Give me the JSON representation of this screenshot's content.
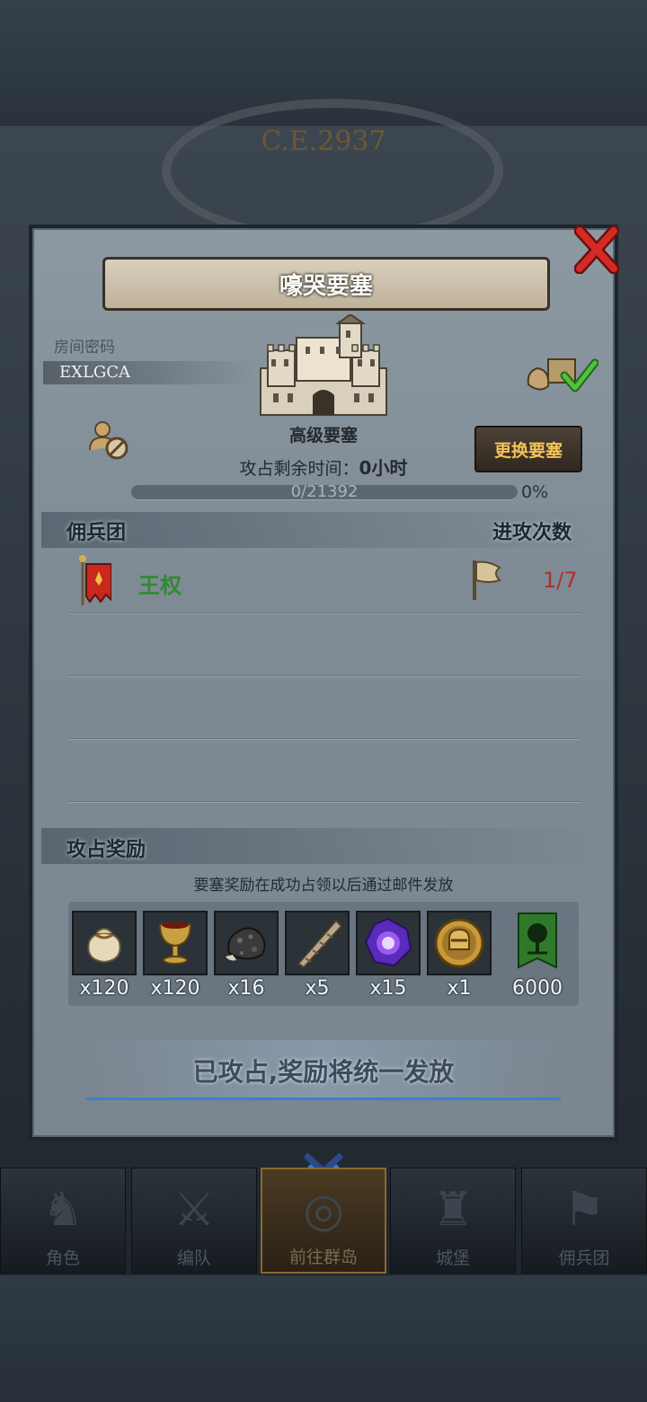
{
  "background": {
    "era": "C.E.2937"
  },
  "dialog": {
    "title": "嚎哭要塞",
    "room_label": "房间密码",
    "room_code": "EXLGCA",
    "fortress_type": "高级要塞",
    "time_left_label": "攻占剩余时间：",
    "time_left_value": "0小时",
    "progress_text": "0/21392",
    "progress_percent": "0%",
    "progress_fraction": 0,
    "change_button": "更换要塞",
    "mercenary_header": "佣兵团",
    "attack_count_header": "进攻次数",
    "mercenaries": [
      {
        "name": "王权",
        "attacks": "1/7"
      }
    ],
    "rewards_header": "攻占奖励",
    "reward_notice": "要塞奖励在成功占领以后通过邮件发放",
    "rewards": [
      {
        "icon": "pouch-icon",
        "qty": "x120"
      },
      {
        "icon": "goblet-icon",
        "qty": "x120"
      },
      {
        "icon": "ore-icon",
        "qty": "x16"
      },
      {
        "icon": "horn-icon",
        "qty": "x5"
      },
      {
        "icon": "magic-crystal-icon",
        "qty": "x15"
      },
      {
        "icon": "helmet-medal-icon",
        "qty": "x1"
      },
      {
        "icon": "tree-banner-icon",
        "qty": "6000"
      }
    ],
    "result_text": "已攻占,奖励将统一发放"
  },
  "nav": {
    "items": [
      {
        "label": "角色",
        "icon": "knight-icon"
      },
      {
        "label": "编队",
        "icon": "squad-icon"
      },
      {
        "label": "前往群岛",
        "icon": "islands-icon"
      },
      {
        "label": "城堡",
        "icon": "castle-icon"
      },
      {
        "label": "佣兵团",
        "icon": "mercenary-icon"
      }
    ],
    "active_index": 2
  },
  "colors": {
    "accent_gold": "#f2c35a",
    "merc_name_green": "#2f8a32",
    "attack_count_red": "#b03030",
    "result_underline_blue": "#3b7fd0",
    "close_red": "#d42a24"
  }
}
